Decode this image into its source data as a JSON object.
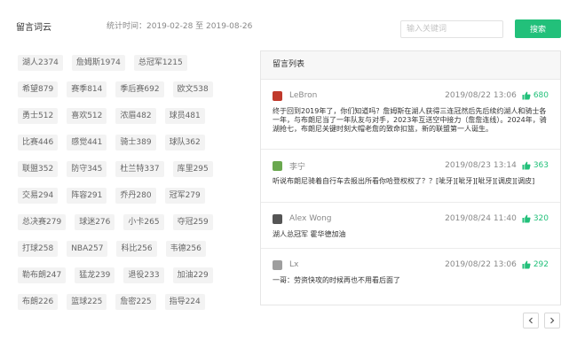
{
  "header": {
    "title": "留言词云",
    "stat_time": "统计时间：2019-02-28 至 2019-08-26",
    "search_placeholder": "输入关键词",
    "search_button": "搜索"
  },
  "tag_rows": [
    [
      "湖人2374",
      "詹姆斯1974",
      "总冠军1215"
    ],
    [
      "希望879",
      "赛季814",
      "季后赛692",
      "欧文538"
    ],
    [
      "勇士512",
      "喜欢512",
      "浓眉482",
      "球员481"
    ],
    [
      "比赛446",
      "感觉441",
      "骑士389",
      "球队362"
    ],
    [
      "联盟352",
      "防守345",
      "杜兰特337",
      "库里295"
    ],
    [
      "交易294",
      "阵容291",
      "乔丹280",
      "冠军279"
    ],
    [
      "总决赛279",
      "球迷276",
      "小卡265",
      "夺冠259"
    ],
    [
      "打球258",
      "NBA257",
      "科比256",
      "韦德256"
    ],
    [
      "勒布朗247",
      "猛龙239",
      "退役233",
      "加油229"
    ],
    [
      "布朗226",
      "篮球225",
      "詹密225",
      "指导224"
    ]
  ],
  "messages_panel": {
    "title": "留言列表",
    "messages": [
      {
        "user": "LeBron",
        "avatar_color": "#c0392b",
        "time": "2019/08/22 13:06",
        "likes": "680",
        "content": "终于回到2019年了，你们知道吗？詹姆斯在湖人获得三连冠然后先后续约湖人和骑士各一年，与布朗尼当了一年队友与对手，2023年互送空中接力（詹詹连线）。2024年，骑湖抢七，布朗尼关键时刻大帽老詹的致命扣篮，新的联盟第一人诞生。"
      },
      {
        "user": "李宁",
        "avatar_color": "#6aa84f",
        "time": "2019/08/23 13:14",
        "likes": "363",
        "content": "听说布朗尼骑着自行车去报出所看你哈登权权了？？[呲牙][呲牙][呲牙][调皮][调皮]"
      },
      {
        "user": "Alex Wong",
        "avatar_color": "#555555",
        "time": "2019/08/24 11:40",
        "likes": "320",
        "content": "湖人总冠军 霍华德加油"
      },
      {
        "user": "Lx",
        "avatar_color": "#9e9e9e",
        "time": "2019/08/22 13:06",
        "likes": "292",
        "content": "一哥：劳资快攻的时候再也不用看后面了"
      }
    ]
  },
  "colors": {
    "accent": "#22c07a"
  },
  "icons": {
    "like": "thumbs-up-icon",
    "prev": "chevron-left-icon",
    "next": "chevron-right-icon"
  }
}
